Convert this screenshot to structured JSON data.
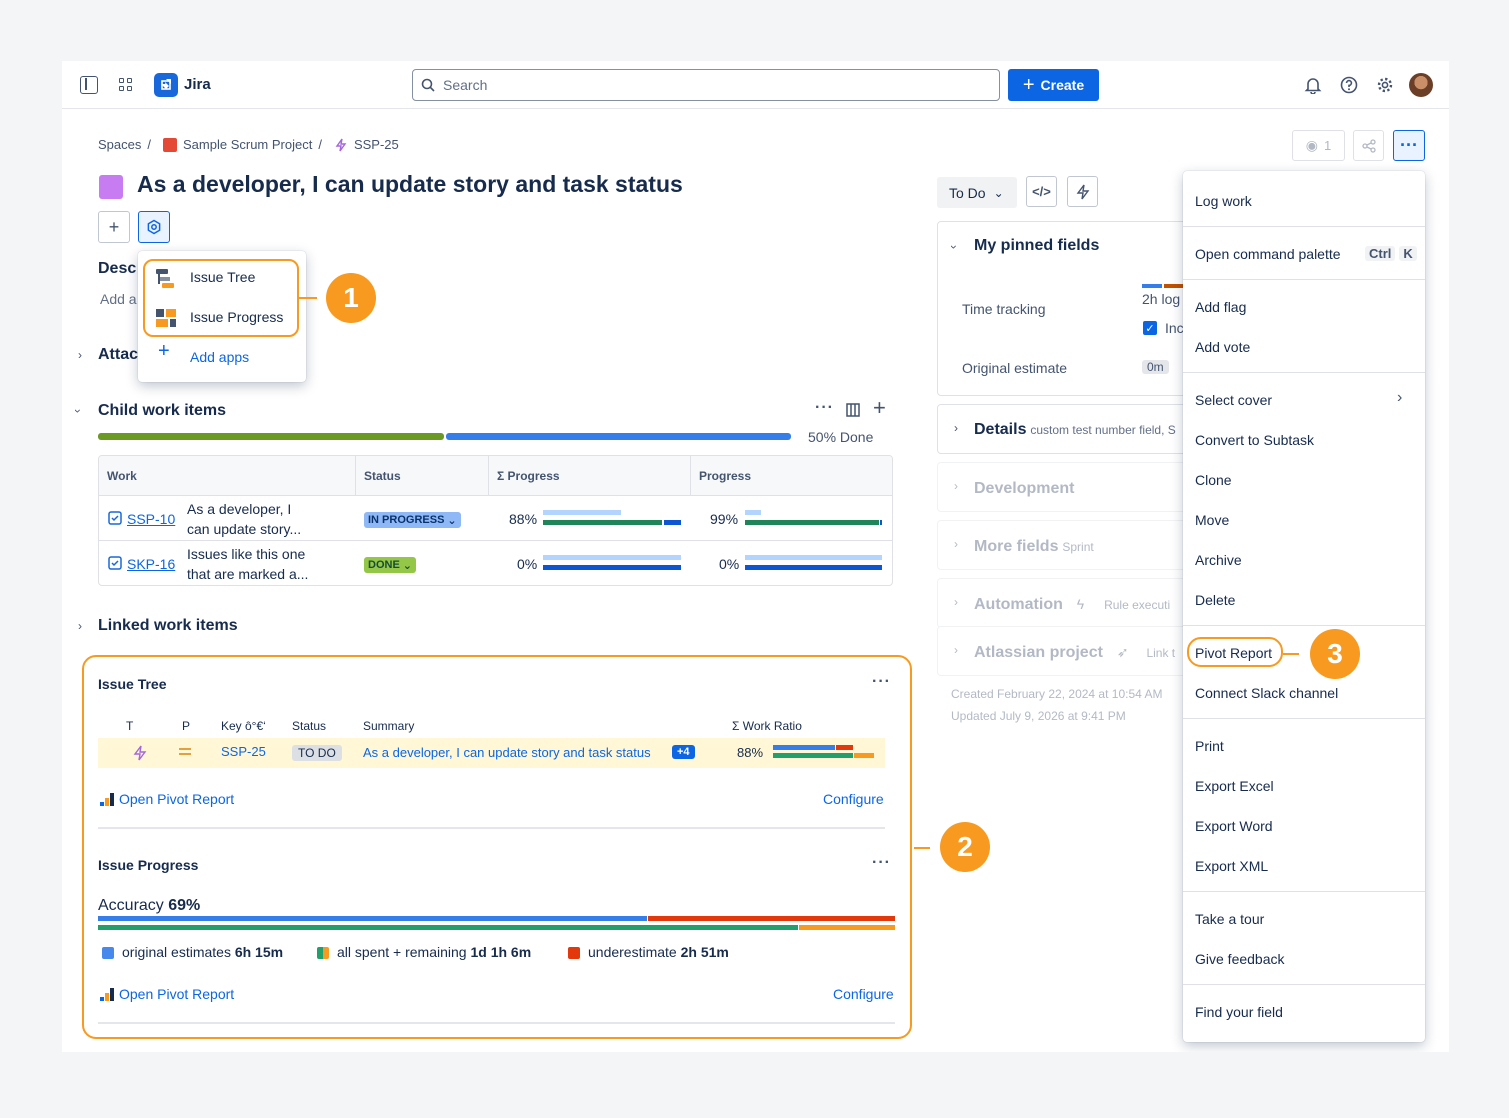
{
  "app": {
    "name": "Jira"
  },
  "topbar": {
    "search_placeholder": "Search",
    "create_label": "Create"
  },
  "breadcrumbs": {
    "spaces": "Spaces",
    "project": "Sample Scrum Project",
    "issue_key": "SSP-25",
    "sep": "/"
  },
  "issue": {
    "title": "As a developer, I can update story and task status",
    "color": "#c77cf2"
  },
  "description": {
    "heading": "Desc",
    "placeholder": "Add a"
  },
  "apps_popup": {
    "items": [
      {
        "label": "Issue Tree",
        "icon": "issue-tree-icon"
      },
      {
        "label": "Issue Progress",
        "icon": "issue-progress-icon"
      }
    ],
    "add_apps": "Add apps"
  },
  "callouts": [
    "1",
    "2",
    "3"
  ],
  "attachments": {
    "heading": "Attac"
  },
  "child_items": {
    "heading": "Child work items",
    "done_text": "50% Done",
    "done_fraction": 0.5,
    "columns": [
      "Work",
      "Status",
      "Σ Progress",
      "Progress"
    ],
    "rows": [
      {
        "key": "SSP-10",
        "summary_line1": "As a developer, I",
        "summary_line2": "can update story...",
        "status": "IN PROGRESS",
        "sum_progress": "88%",
        "progress": "99%"
      },
      {
        "key": "SKP-16",
        "summary_line1": "Issues like this one",
        "summary_line2": "that are marked a...",
        "status": "DONE",
        "sum_progress": "0%",
        "progress": "0%"
      }
    ]
  },
  "linked_items": {
    "heading": "Linked work items"
  },
  "issue_tree": {
    "heading": "Issue Tree",
    "columns": {
      "t": "T",
      "p": "P",
      "key": "Key ô°€‘",
      "status": "Status",
      "summary": "Summary",
      "ratio": "Σ Work Ratio"
    },
    "row": {
      "key": "SSP-25",
      "status": "TO DO",
      "summary": "As a developer, I can update story and task status",
      "more": "+4",
      "ratio": "88%"
    },
    "open_report": "Open Pivot Report",
    "configure": "Configure"
  },
  "issue_progress": {
    "heading": "Issue Progress",
    "accuracy_label": "Accuracy",
    "accuracy_value": "69%",
    "legend": [
      {
        "label": "original estimates",
        "value": "6h 15m",
        "color": "#4688ec"
      },
      {
        "label": "all spent + remaining",
        "value": "1d 1h 6m",
        "color": "#22a06b"
      },
      {
        "label": "underestimate",
        "value": "2h 51m",
        "color": "#e2380c"
      }
    ],
    "open_report": "Open Pivot Report",
    "configure": "Configure"
  },
  "right_panel": {
    "status_button": "To Do",
    "watch_count": "1",
    "pinned": {
      "heading": "My pinned fields",
      "time_tracking": "Time tracking",
      "logged": "2h log",
      "checkbox_label": "Inc",
      "original_estimate": "Original estimate",
      "oe_value": "0m"
    },
    "details": {
      "heading": "Details",
      "sub": "custom test number field, S"
    },
    "development": "Development",
    "more_fields": {
      "heading": "More fields",
      "sub": "Sprint"
    },
    "automation": {
      "heading": "Automation",
      "sub": "Rule executi"
    },
    "atlassian": {
      "heading": "Atlassian project",
      "sub": "Link t"
    },
    "created": "Created February 22, 2024 at 10:54 AM",
    "updated": "Updated July 9, 2026 at 9:41 PM"
  },
  "menu": {
    "items": [
      "Log work",
      "Open command palette",
      "Add flag",
      "Add vote",
      "Select cover",
      "Convert to Subtask",
      "Clone",
      "Move",
      "Archive",
      "Delete",
      "Pivot Report",
      "Connect Slack channel",
      "Print",
      "Export Excel",
      "Export Word",
      "Export XML",
      "Take a tour",
      "Give feedback",
      "Find your field"
    ],
    "shortcut": [
      "Ctrl",
      "K"
    ]
  },
  "colors": {
    "accent": "#0c66e4",
    "callout": "#f79a1f",
    "done_green": "#6a9a23",
    "progress_blue": "#357de8"
  }
}
